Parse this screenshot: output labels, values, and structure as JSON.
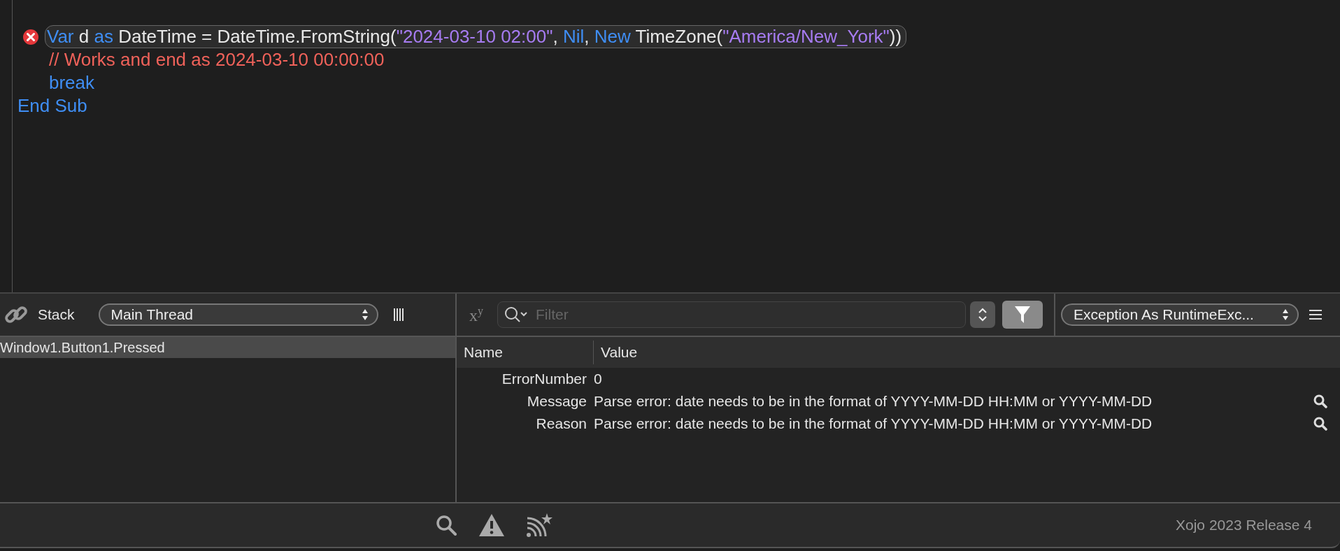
{
  "code": {
    "lines": [
      {
        "kind": "body",
        "error": true,
        "tokens": [
          {
            "kind": "keyword",
            "text": "Var"
          },
          {
            "kind": "plain",
            "text": " d "
          },
          {
            "kind": "keyword",
            "text": "as"
          },
          {
            "kind": "plain",
            "text": " DateTime = DateTime.FromString("
          },
          {
            "kind": "string",
            "text": "\"2024-03-10 02:00\""
          },
          {
            "kind": "plain",
            "text": ", "
          },
          {
            "kind": "keyword",
            "text": "Nil"
          },
          {
            "kind": "plain",
            "text": ", "
          },
          {
            "kind": "keyword",
            "text": "New"
          },
          {
            "kind": "plain",
            "text": " TimeZone("
          },
          {
            "kind": "string",
            "text": "\"America/New_York\""
          },
          {
            "kind": "plain",
            "text": "))"
          }
        ]
      },
      {
        "kind": "body",
        "error": false,
        "tokens": [
          {
            "kind": "comment",
            "text": "// Works and end as 2024-03-10 00:00:00"
          }
        ]
      },
      {
        "kind": "body",
        "error": false,
        "tokens": [
          {
            "kind": "keyword",
            "text": "break"
          }
        ]
      },
      {
        "kind": "end",
        "error": false,
        "tokens": [
          {
            "kind": "keyword",
            "text": "End Sub"
          }
        ]
      }
    ]
  },
  "stack": {
    "title": "Stack",
    "thread": "Main Thread",
    "frames": [
      {
        "label": "Window1.Button1.Pressed",
        "selected": true
      }
    ]
  },
  "variables": {
    "superscript_toggle": "x$^{y}$",
    "filter": {
      "placeholder": "Filter"
    },
    "scope": "Exception As RuntimeExc...",
    "columns": [
      "Name",
      "Value"
    ],
    "rows": [
      {
        "name": "ErrorNumber",
        "value": "0",
        "inspectable": false
      },
      {
        "name": "Message",
        "value": "Parse error: date needs to be in the format of YYYY-MM-DD HH:MM or YYYY-MM-DD",
        "inspectable": true
      },
      {
        "name": "Reason",
        "value": "Parse error: date needs to be in the format of YYYY-MM-DD HH:MM or YYYY-MM-DD",
        "inspectable": true
      }
    ]
  },
  "status_bar": {
    "version": "Xojo 2023 Release 4"
  }
}
